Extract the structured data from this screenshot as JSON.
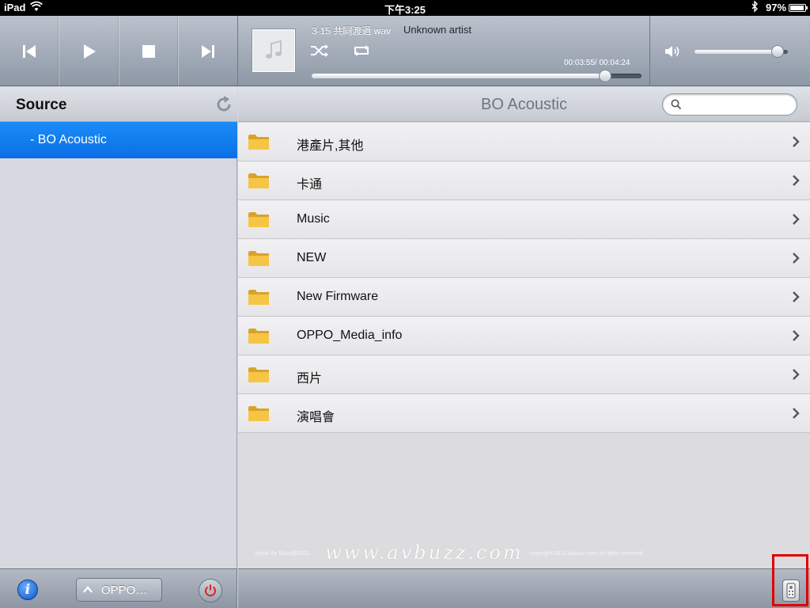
{
  "status_bar": {
    "carrier": "iPad",
    "time": "下午3:25",
    "battery": "97%",
    "battery_level": 0.97,
    "icons": [
      "wifi-icon",
      "bluetooth-icon",
      "battery-icon"
    ]
  },
  "player": {
    "controls": [
      "previous-track-icon",
      "play-icon",
      "stop-icon",
      "next-track-icon"
    ],
    "track_title": "3-15 共同渡過.wav",
    "artist": "Unknown artist",
    "elapsed": "00:03:55",
    "duration": "00:04:24",
    "elapsed_display": "00:03:55/ 00:04:24",
    "progress": 0.89,
    "volume": 0.89,
    "icons": [
      "music-note-icon",
      "shuffle-icon",
      "repeat-icon",
      "speaker-icon"
    ]
  },
  "sidebar": {
    "title": "Source",
    "items": [
      {
        "label": "- BO Acoustic",
        "selected": true
      }
    ]
  },
  "main": {
    "title": "BO Acoustic",
    "search_placeholder": "",
    "folders": [
      {
        "label": "港產片,其他"
      },
      {
        "label": "卡通"
      },
      {
        "label": "Music"
      },
      {
        "label": "NEW"
      },
      {
        "label": "New Firmware"
      },
      {
        "label": "OPPO_Media_info"
      },
      {
        "label": "西片"
      },
      {
        "label": "演唱會"
      }
    ]
  },
  "watermark": {
    "left": "photo By Buzz@2013",
    "center": "www.avbuzz.com",
    "right": "copyright 2013 avbuzz.com all rights reserved"
  },
  "bottom_bar": {
    "device_label": "OPPO…",
    "icons": [
      "info-icon",
      "chevron-up-icon",
      "power-icon",
      "remote-control-icon"
    ]
  },
  "colors": {
    "selection": "#0a6fe6",
    "highlight_box": "#e00000",
    "power": "#e02020"
  }
}
